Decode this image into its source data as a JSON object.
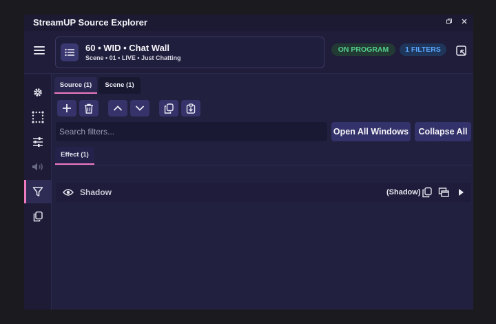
{
  "window": {
    "title": "StreamUP Source Explorer",
    "controls": [
      "restore-icon",
      "close-icon"
    ]
  },
  "header": {
    "menu_icon": "hamburger-icon",
    "source_title": "60 • WID • Chat Wall",
    "source_subtitle": "Scene • 01 • LIVE • Just Chatting",
    "program_badge": "ON PROGRAM",
    "filters_badge": "1 FILTERS",
    "exit_icon": "open-external-icon"
  },
  "sidebar": {
    "items": [
      {
        "icon": "gear-icon",
        "active": false
      },
      {
        "icon": "transform-grid-icon",
        "active": false
      },
      {
        "icon": "sliders-icon",
        "active": false
      },
      {
        "icon": "speaker-icon",
        "active": false
      },
      {
        "icon": "filter-icon",
        "active": true
      },
      {
        "icon": "copy-icon",
        "active": false
      }
    ]
  },
  "tabs": {
    "source": "Source (1)",
    "scene": "Scene (1)"
  },
  "toolbar": {
    "buttons": [
      "add-icon",
      "trash-icon",
      "chevron-up-icon",
      "chevron-down-icon",
      "copy-icon",
      "paste-icon"
    ]
  },
  "search": {
    "placeholder": "Search filters...",
    "value": ""
  },
  "actions": {
    "open_all": "Open All Windows",
    "collapse_all": "Collapse All"
  },
  "effect_tab": "Effect (1)",
  "filters": [
    {
      "name": "Shadow",
      "type": "(Shadow)",
      "visible": true
    }
  ],
  "colors": {
    "accent": "#f07ac0",
    "on_program": "#55d18e",
    "filters_badge": "#5aa6ff",
    "window_bg": "#22203f"
  }
}
